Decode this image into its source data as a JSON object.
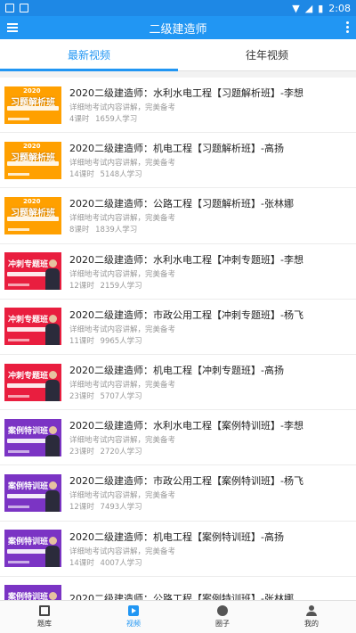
{
  "statusbar": {
    "time": "2:08"
  },
  "appbar": {
    "title": "二级建造师"
  },
  "tabs": [
    {
      "label": "最新视频",
      "active": true
    },
    {
      "label": "往年视频",
      "active": false
    }
  ],
  "items": [
    {
      "title": "2020二级建造师：水利水电工程【习题解析班】-李想",
      "desc": "详细地考试内容讲解，完美备考",
      "lessons": "4课时",
      "learners": "1659人学习",
      "thumb": {
        "style": "orange",
        "banner": "习题解析班",
        "year": "2020"
      }
    },
    {
      "title": "2020二级建造师：机电工程【习题解析班】-高扬",
      "desc": "详细地考试内容讲解，完美备考",
      "lessons": "14课时",
      "learners": "5148人学习",
      "thumb": {
        "style": "orange",
        "banner": "习题解析班",
        "year": "2020"
      }
    },
    {
      "title": "2020二级建造师：公路工程【习题解析班】-张林娜",
      "desc": "详细地考试内容讲解，完美备考",
      "lessons": "8课时",
      "learners": "1839人学习",
      "thumb": {
        "style": "orange",
        "banner": "习题解析班",
        "year": "2020"
      }
    },
    {
      "title": "2020二级建造师：水利水电工程【冲刺专题班】-李想",
      "desc": "详细地考试内容讲解，完美备考",
      "lessons": "12课时",
      "learners": "2159人学习",
      "thumb": {
        "style": "red",
        "banner": "冲刺专题班",
        "year": ""
      }
    },
    {
      "title": "2020二级建造师：市政公用工程【冲刺专题班】-杨飞",
      "desc": "详细地考试内容讲解，完美备考",
      "lessons": "11课时",
      "learners": "9965人学习",
      "thumb": {
        "style": "red",
        "banner": "冲刺专题班",
        "year": ""
      }
    },
    {
      "title": "2020二级建造师：机电工程【冲刺专题班】-高扬",
      "desc": "详细地考试内容讲解，完美备考",
      "lessons": "23课时",
      "learners": "5707人学习",
      "thumb": {
        "style": "red",
        "banner": "冲刺专题班",
        "year": ""
      }
    },
    {
      "title": "2020二级建造师：水利水电工程【案例特训班】-李想",
      "desc": "详细地考试内容讲解，完美备考",
      "lessons": "23课时",
      "learners": "2720人学习",
      "thumb": {
        "style": "purple",
        "banner": "案例特训班",
        "year": ""
      }
    },
    {
      "title": "2020二级建造师：市政公用工程【案例特训班】-杨飞",
      "desc": "详细地考试内容讲解，完美备考",
      "lessons": "12课时",
      "learners": "7493人学习",
      "thumb": {
        "style": "purple",
        "banner": "案例特训班",
        "year": ""
      }
    },
    {
      "title": "2020二级建造师：机电工程【案例特训班】-高扬",
      "desc": "详细地考试内容讲解，完美备考",
      "lessons": "14课时",
      "learners": "4007人学习",
      "thumb": {
        "style": "purple",
        "banner": "案例特训班",
        "year": ""
      }
    },
    {
      "title": "2020二级建造师：公路工程【案例特训班】-张林娜",
      "desc": "",
      "lessons": "",
      "learners": "",
      "thumb": {
        "style": "purple",
        "banner": "案例特训班",
        "year": ""
      }
    }
  ],
  "bottomnav": [
    {
      "label": "题库",
      "icon": "question-bank-icon",
      "active": false
    },
    {
      "label": "视频",
      "icon": "video-icon",
      "active": true
    },
    {
      "label": "圈子",
      "icon": "community-icon",
      "active": false
    },
    {
      "label": "我的",
      "icon": "profile-icon",
      "active": false
    }
  ],
  "colors": {
    "primary": "#2196f3",
    "statusbar": "#1e88e5",
    "orange": "#ffa000",
    "red": "#e91e3f",
    "purple": "#7b34c4"
  }
}
